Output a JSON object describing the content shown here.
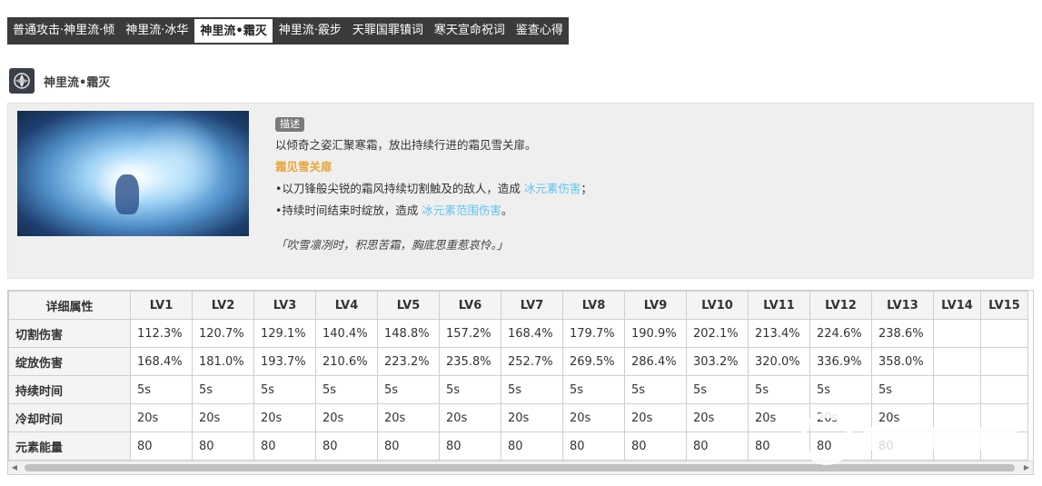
{
  "tabs": [
    {
      "label": "普通攻击·神里流·倾",
      "active": false
    },
    {
      "label": "神里流·冰华",
      "active": false
    },
    {
      "label": "神里流•霜灭",
      "active": true
    },
    {
      "label": "神里流·霰步",
      "active": false
    },
    {
      "label": "天罪国罪镇词",
      "active": false
    },
    {
      "label": "寒天宣命祝词",
      "active": false
    },
    {
      "label": "鉴查心得",
      "active": false
    }
  ],
  "skill": {
    "title": "神里流•霜灭",
    "icon": "skill-emblem-icon",
    "badge": "描述",
    "description": "以倾奇之姿汇聚寒霜，放出持续行进的霜见雪关扉。",
    "subtitle": "霜见雪关扉",
    "line1_prefix": "•以刀锋般尖锐的霜风持续切割触及的敌人，造成 ",
    "line1_link": "冰元素伤害",
    "line1_suffix": "；",
    "line2_prefix": "•持续时间结束时绽放，造成 ",
    "line2_link": "冰元素范围伤害",
    "line2_suffix": "。",
    "quote": "「吹雪凛冽时，积思苦霜，胸底思重惹哀怜。」"
  },
  "table": {
    "headers": [
      "详细属性",
      "LV1",
      "LV2",
      "LV3",
      "LV4",
      "LV5",
      "LV6",
      "LV7",
      "LV8",
      "LV9",
      "LV10",
      "LV11",
      "LV12",
      "LV13",
      "LV14",
      "LV15"
    ],
    "rows": [
      {
        "name": "切割伤害",
        "values": [
          "112.3%",
          "120.7%",
          "129.1%",
          "140.4%",
          "148.8%",
          "157.2%",
          "168.4%",
          "179.7%",
          "190.9%",
          "202.1%",
          "213.4%",
          "224.6%",
          "238.6%",
          "",
          ""
        ]
      },
      {
        "name": "绽放伤害",
        "values": [
          "168.4%",
          "181.0%",
          "193.7%",
          "210.6%",
          "223.2%",
          "235.8%",
          "252.7%",
          "269.5%",
          "286.4%",
          "303.2%",
          "320.0%",
          "336.9%",
          "358.0%",
          "",
          ""
        ]
      },
      {
        "name": "持续时间",
        "values": [
          "5s",
          "5s",
          "5s",
          "5s",
          "5s",
          "5s",
          "5s",
          "5s",
          "5s",
          "5s",
          "5s",
          "5s",
          "5s",
          "",
          ""
        ]
      },
      {
        "name": "冷却时间",
        "values": [
          "20s",
          "20s",
          "20s",
          "20s",
          "20s",
          "20s",
          "20s",
          "20s",
          "20s",
          "20s",
          "20s",
          "20s",
          "20s",
          "",
          ""
        ]
      },
      {
        "name": "元素能量",
        "values": [
          "80",
          "80",
          "80",
          "80",
          "80",
          "80",
          "80",
          "80",
          "80",
          "80",
          "80",
          "80",
          "80",
          "",
          ""
        ]
      }
    ]
  },
  "colors": {
    "tab_bar": "#3b3b3b",
    "highlight_orange": "#e8a43a",
    "link_blue": "#5fc6f0",
    "desc_bg": "#efefef"
  }
}
